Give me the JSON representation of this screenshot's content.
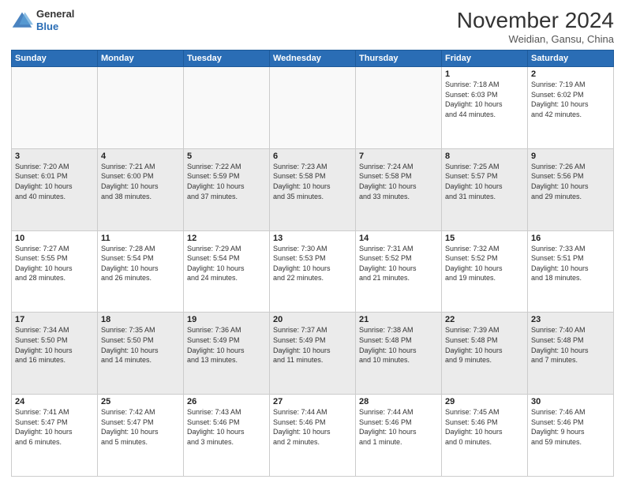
{
  "header": {
    "logo_line1": "General",
    "logo_line2": "Blue",
    "month": "November 2024",
    "location": "Weidian, Gansu, China"
  },
  "weekdays": [
    "Sunday",
    "Monday",
    "Tuesday",
    "Wednesday",
    "Thursday",
    "Friday",
    "Saturday"
  ],
  "weeks": [
    [
      {
        "day": "",
        "info": ""
      },
      {
        "day": "",
        "info": ""
      },
      {
        "day": "",
        "info": ""
      },
      {
        "day": "",
        "info": ""
      },
      {
        "day": "",
        "info": ""
      },
      {
        "day": "1",
        "info": "Sunrise: 7:18 AM\nSunset: 6:03 PM\nDaylight: 10 hours\nand 44 minutes."
      },
      {
        "day": "2",
        "info": "Sunrise: 7:19 AM\nSunset: 6:02 PM\nDaylight: 10 hours\nand 42 minutes."
      }
    ],
    [
      {
        "day": "3",
        "info": "Sunrise: 7:20 AM\nSunset: 6:01 PM\nDaylight: 10 hours\nand 40 minutes."
      },
      {
        "day": "4",
        "info": "Sunrise: 7:21 AM\nSunset: 6:00 PM\nDaylight: 10 hours\nand 38 minutes."
      },
      {
        "day": "5",
        "info": "Sunrise: 7:22 AM\nSunset: 5:59 PM\nDaylight: 10 hours\nand 37 minutes."
      },
      {
        "day": "6",
        "info": "Sunrise: 7:23 AM\nSunset: 5:58 PM\nDaylight: 10 hours\nand 35 minutes."
      },
      {
        "day": "7",
        "info": "Sunrise: 7:24 AM\nSunset: 5:58 PM\nDaylight: 10 hours\nand 33 minutes."
      },
      {
        "day": "8",
        "info": "Sunrise: 7:25 AM\nSunset: 5:57 PM\nDaylight: 10 hours\nand 31 minutes."
      },
      {
        "day": "9",
        "info": "Sunrise: 7:26 AM\nSunset: 5:56 PM\nDaylight: 10 hours\nand 29 minutes."
      }
    ],
    [
      {
        "day": "10",
        "info": "Sunrise: 7:27 AM\nSunset: 5:55 PM\nDaylight: 10 hours\nand 28 minutes."
      },
      {
        "day": "11",
        "info": "Sunrise: 7:28 AM\nSunset: 5:54 PM\nDaylight: 10 hours\nand 26 minutes."
      },
      {
        "day": "12",
        "info": "Sunrise: 7:29 AM\nSunset: 5:54 PM\nDaylight: 10 hours\nand 24 minutes."
      },
      {
        "day": "13",
        "info": "Sunrise: 7:30 AM\nSunset: 5:53 PM\nDaylight: 10 hours\nand 22 minutes."
      },
      {
        "day": "14",
        "info": "Sunrise: 7:31 AM\nSunset: 5:52 PM\nDaylight: 10 hours\nand 21 minutes."
      },
      {
        "day": "15",
        "info": "Sunrise: 7:32 AM\nSunset: 5:52 PM\nDaylight: 10 hours\nand 19 minutes."
      },
      {
        "day": "16",
        "info": "Sunrise: 7:33 AM\nSunset: 5:51 PM\nDaylight: 10 hours\nand 18 minutes."
      }
    ],
    [
      {
        "day": "17",
        "info": "Sunrise: 7:34 AM\nSunset: 5:50 PM\nDaylight: 10 hours\nand 16 minutes."
      },
      {
        "day": "18",
        "info": "Sunrise: 7:35 AM\nSunset: 5:50 PM\nDaylight: 10 hours\nand 14 minutes."
      },
      {
        "day": "19",
        "info": "Sunrise: 7:36 AM\nSunset: 5:49 PM\nDaylight: 10 hours\nand 13 minutes."
      },
      {
        "day": "20",
        "info": "Sunrise: 7:37 AM\nSunset: 5:49 PM\nDaylight: 10 hours\nand 11 minutes."
      },
      {
        "day": "21",
        "info": "Sunrise: 7:38 AM\nSunset: 5:48 PM\nDaylight: 10 hours\nand 10 minutes."
      },
      {
        "day": "22",
        "info": "Sunrise: 7:39 AM\nSunset: 5:48 PM\nDaylight: 10 hours\nand 9 minutes."
      },
      {
        "day": "23",
        "info": "Sunrise: 7:40 AM\nSunset: 5:48 PM\nDaylight: 10 hours\nand 7 minutes."
      }
    ],
    [
      {
        "day": "24",
        "info": "Sunrise: 7:41 AM\nSunset: 5:47 PM\nDaylight: 10 hours\nand 6 minutes."
      },
      {
        "day": "25",
        "info": "Sunrise: 7:42 AM\nSunset: 5:47 PM\nDaylight: 10 hours\nand 5 minutes."
      },
      {
        "day": "26",
        "info": "Sunrise: 7:43 AM\nSunset: 5:46 PM\nDaylight: 10 hours\nand 3 minutes."
      },
      {
        "day": "27",
        "info": "Sunrise: 7:44 AM\nSunset: 5:46 PM\nDaylight: 10 hours\nand 2 minutes."
      },
      {
        "day": "28",
        "info": "Sunrise: 7:44 AM\nSunset: 5:46 PM\nDaylight: 10 hours\nand 1 minute."
      },
      {
        "day": "29",
        "info": "Sunrise: 7:45 AM\nSunset: 5:46 PM\nDaylight: 10 hours\nand 0 minutes."
      },
      {
        "day": "30",
        "info": "Sunrise: 7:46 AM\nSunset: 5:46 PM\nDaylight: 9 hours\nand 59 minutes."
      }
    ]
  ]
}
